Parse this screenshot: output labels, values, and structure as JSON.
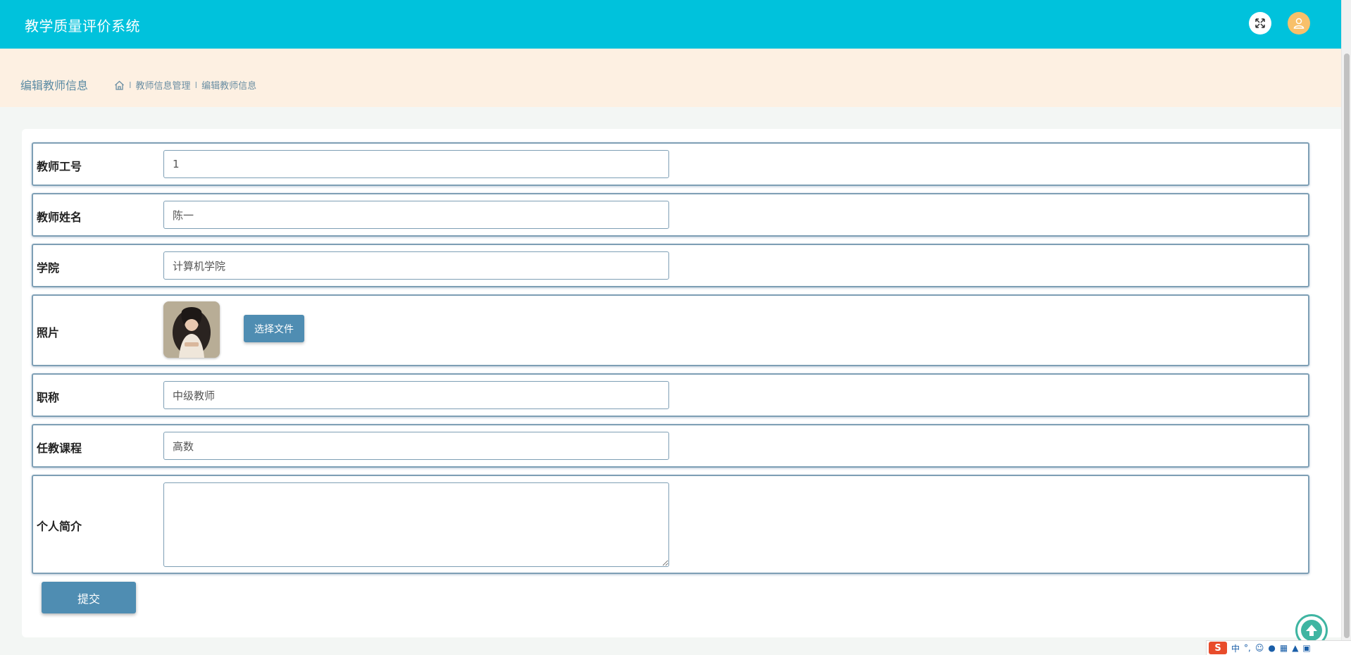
{
  "header": {
    "app_title": "教学质量评价系统"
  },
  "breadcrumb": {
    "page_title": "编辑教师信息",
    "items": [
      "教师信息管理",
      "编辑教师信息"
    ],
    "separator": "I"
  },
  "form": {
    "teacher_id": {
      "label": "教师工号",
      "value": "1"
    },
    "teacher_name": {
      "label": "教师姓名",
      "value": "陈一"
    },
    "college": {
      "label": "学院",
      "value": "计算机学院"
    },
    "photo": {
      "label": "照片",
      "button_label": "选择文件"
    },
    "title": {
      "label": "职称",
      "value": "中级教师"
    },
    "course": {
      "label": "任教课程",
      "value": "高数"
    },
    "bio": {
      "label": "个人简介",
      "value": ""
    },
    "submit_label": "提交"
  },
  "ime": {
    "logo": "S",
    "mode": "中"
  },
  "colors": {
    "header_bg": "#00c2dc",
    "breadcrumb_bg": "#fdf0e2",
    "button_bg": "#4f8db2",
    "border": "#7e9fb5"
  }
}
